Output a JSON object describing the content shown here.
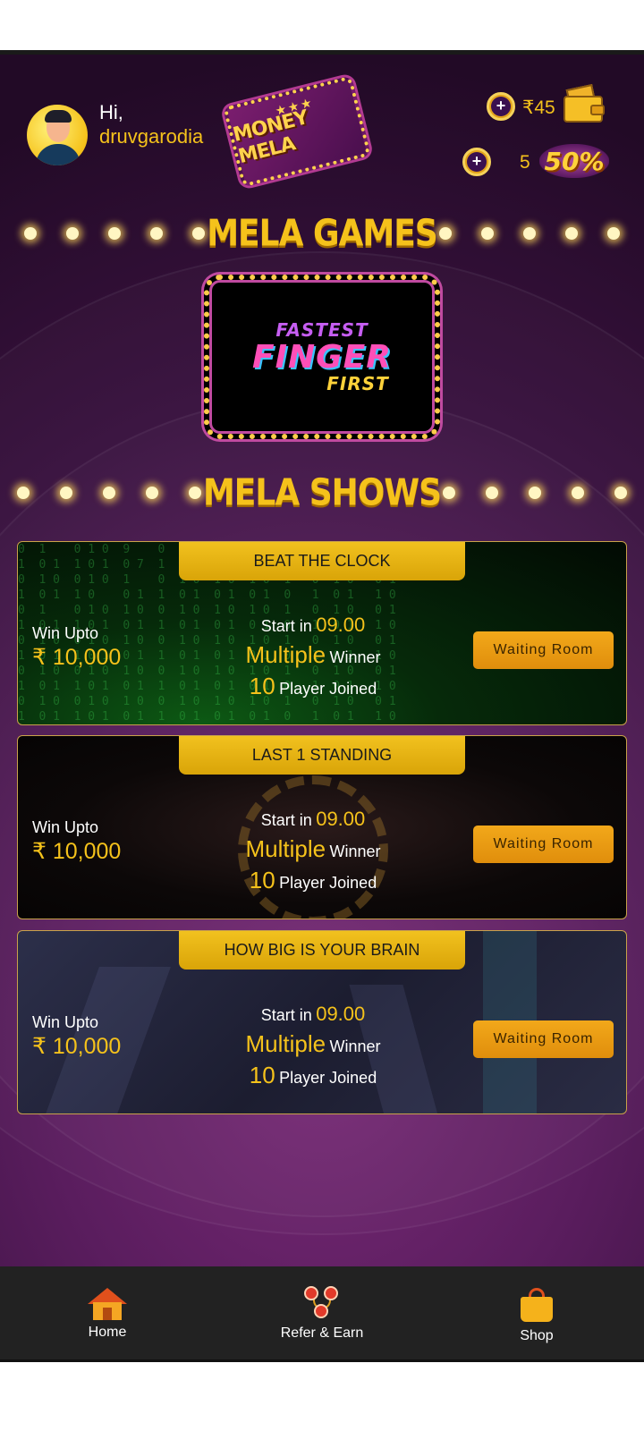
{
  "header": {
    "greeting": "Hi,",
    "username": "druvgarodia",
    "logo_text": "MONEY MELA",
    "balance": "₹45",
    "count": "5",
    "badge": "50%"
  },
  "sections": {
    "games_title": "MELA GAMES",
    "shows_title": "MELA SHOWS"
  },
  "game": {
    "line1": "FASTEST",
    "line2": "FINGER",
    "line3": "FIRST"
  },
  "shows": [
    {
      "title": "BEAT THE CLOCK",
      "win_label": "Win Upto",
      "win_amount": "₹ 10,000",
      "start_label": "Start in",
      "start_time": "09.00",
      "multiple": "Multiple",
      "winner_label": "Winner",
      "players": "10",
      "players_label": "Player Joined",
      "button": "Waiting Room"
    },
    {
      "title": "LAST 1 STANDING",
      "win_label": "Win Upto",
      "win_amount": "₹ 10,000",
      "start_label": "Start in",
      "start_time": "09.00",
      "multiple": "Multiple",
      "winner_label": "Winner",
      "players": "10",
      "players_label": "Player Joined",
      "button": "Waiting Room"
    },
    {
      "title": "HOW BIG IS YOUR BRAIN",
      "win_label": "Win Upto",
      "win_amount": "₹ 10,000",
      "start_label": "Start in",
      "start_time": "09.00",
      "multiple": "Multiple",
      "winner_label": "Winner",
      "players": "10",
      "players_label": "Player Joined",
      "button": "Waiting Room"
    }
  ],
  "nav": {
    "home": "Home",
    "refer": "Refer & Earn",
    "shop": "Shop"
  }
}
